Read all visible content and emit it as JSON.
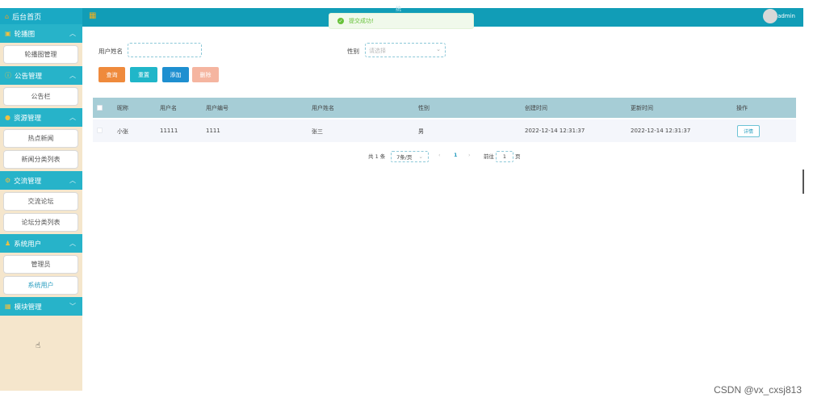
{
  "sidebar": {
    "home": "后台首页",
    "groups": [
      {
        "title": "轮播图",
        "items": [
          "轮播图管理"
        ]
      },
      {
        "title": "公告管理",
        "items": [
          "公告栏"
        ]
      },
      {
        "title": "资源管理",
        "items": [
          "热点新闻",
          "新闻分类列表"
        ]
      },
      {
        "title": "交流管理",
        "items": [
          "交流论坛",
          "论坛分类列表"
        ]
      },
      {
        "title": "系统用户",
        "items": [
          "管理员",
          "系统用户"
        ]
      },
      {
        "title": "模块管理",
        "items": []
      }
    ]
  },
  "topbar": {
    "user": "admin",
    "title_fragment": "统"
  },
  "toast": {
    "message": "提交成功!"
  },
  "search": {
    "name_label": "用户姓名",
    "name_value": "",
    "gender_label": "性别",
    "gender_placeholder": "请选择"
  },
  "buttons": {
    "query": "查询",
    "reset": "重置",
    "add": "添加",
    "delete": "删除"
  },
  "table": {
    "headers": [
      "昵称",
      "用户名",
      "用户编号",
      "用户姓名",
      "性别",
      "创建时间",
      "更新时间",
      "操作"
    ],
    "rows": [
      {
        "nickname": "小张",
        "username": "11111",
        "user_no": "1111",
        "real_name": "张三",
        "gender": "男",
        "created": "2022-12-14 12:31:37",
        "updated": "2022-12-14 12:31:37",
        "action": "详情"
      }
    ]
  },
  "pagination": {
    "total": "共 1 条",
    "page_size": "7条/页",
    "current": "1",
    "goto_label": "前往",
    "goto_value": "1",
    "page_unit": "页"
  },
  "watermark": "CSDN @vx_cxsj813"
}
